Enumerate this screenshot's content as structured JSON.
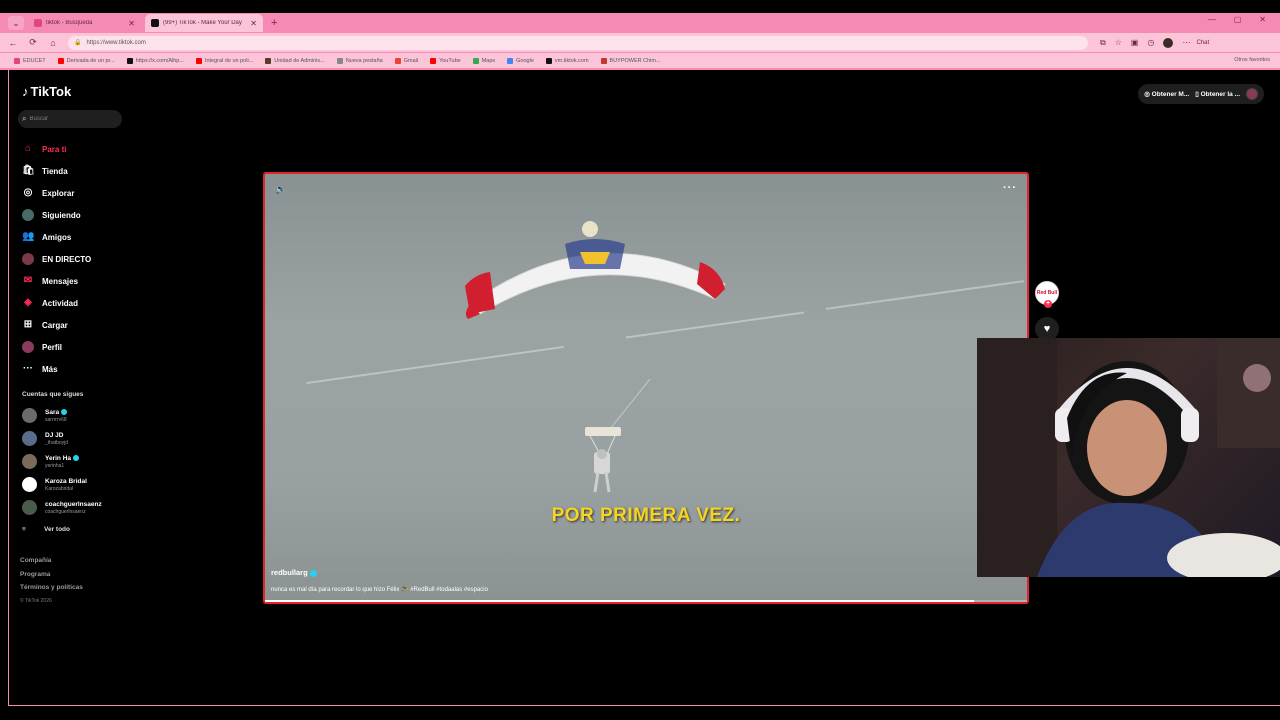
{
  "browser": {
    "tabs": [
      {
        "title": "tiktok - Búsqueda",
        "active": false
      },
      {
        "title": "(99+) TikTok - Make Your Day",
        "active": true
      }
    ],
    "url": "https://www.tiktok.com",
    "chat_label": "Chat",
    "bookmarks": [
      {
        "label": "EDUCET",
        "color": "#e3467f"
      },
      {
        "label": "Derivada de un pr...",
        "color": "#ff0000"
      },
      {
        "label": "https://x.com/Alhp...",
        "color": "#111111"
      },
      {
        "label": "Integral de un poli...",
        "color": "#ff0000"
      },
      {
        "label": "Unidad de Adminis...",
        "color": "#5b3a2a"
      },
      {
        "label": "Nueva pestaña",
        "color": "#888888"
      },
      {
        "label": "Gmail",
        "color": "#ea4335"
      },
      {
        "label": "YouTube",
        "color": "#ff0000"
      },
      {
        "label": "Maps",
        "color": "#34a853"
      },
      {
        "label": "Google",
        "color": "#4285f4"
      },
      {
        "label": "vm.tiktok.com",
        "color": "#111111"
      },
      {
        "label": "BUYPOWER Chim...",
        "color": "#c0392b"
      }
    ],
    "bookmarks_other": "Otros favoritos"
  },
  "tiktok": {
    "logo": "TikTok",
    "search_placeholder": "Buscar",
    "nav": [
      {
        "label": "Para ti",
        "icon": "home-icon",
        "active": true
      },
      {
        "label": "Tienda",
        "icon": "shop-icon",
        "active": false
      },
      {
        "label": "Explorar",
        "icon": "compass-icon",
        "active": false
      },
      {
        "label": "Siguiendo",
        "icon": "following-avatar-icon",
        "active": false
      },
      {
        "label": "Amigos",
        "icon": "friends-icon",
        "active": false
      },
      {
        "label": "EN DIRECTO",
        "icon": "live-icon",
        "active": false
      },
      {
        "label": "Mensajes",
        "icon": "messages-icon",
        "active": false
      },
      {
        "label": "Actividad",
        "icon": "activity-icon",
        "active": false
      },
      {
        "label": "Cargar",
        "icon": "upload-icon",
        "active": false
      },
      {
        "label": "Perfil",
        "icon": "profile-icon",
        "active": false
      },
      {
        "label": "Más",
        "icon": "more-icon",
        "active": false
      }
    ],
    "following_title": "Cuentas que sigues",
    "following": [
      {
        "name": "Sara",
        "handle": "sarrrrrv68",
        "verified": true,
        "color": "#6b6b6b"
      },
      {
        "name": "DJ JD",
        "handle": "_thatboyjd",
        "verified": false,
        "color": "#5b6b8a"
      },
      {
        "name": "Yerin Ha",
        "handle": "yerinha1",
        "verified": true,
        "color": "#7a6b5b"
      },
      {
        "name": "Karoza Bridal",
        "handle": "Karozabridal",
        "verified": false,
        "color": "#ffffff"
      },
      {
        "name": "coachguerlnsaenz",
        "handle": "coachguerlnsaenz",
        "verified": false,
        "color": "#4b5b4b"
      }
    ],
    "see_all": "Ver todo",
    "footer": [
      "Compañía",
      "Programa",
      "Términos y políticas"
    ],
    "copyright": "© TikTok 2026",
    "top_buttons": [
      "Obtener M...",
      "Obtener la ..."
    ],
    "video": {
      "caption": "POR PRIMERA VEZ.",
      "author": "redbullarg",
      "description": "nunca es mal día para recordar lo que hizo Félix 🪂 #RedBull #todaalas #espacio",
      "progress": 0.93
    },
    "creator_avatar_text": "Red Bull"
  }
}
